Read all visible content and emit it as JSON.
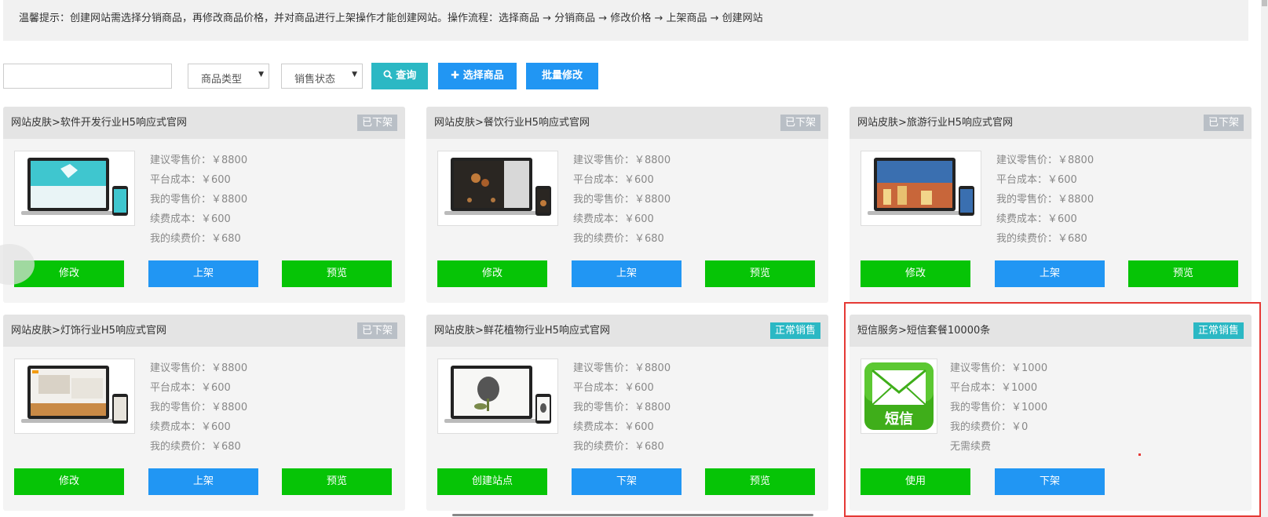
{
  "tip": "温馨提示：创建网站需选择分销商品，再修改商品价格，并对商品进行上架操作才能创建网站。操作流程：选择商品 → 分销商品 → 修改价格 → 上架商品 → 创建网站",
  "toolbar": {
    "search_value": "",
    "type_select": "商品类型",
    "status_select": "销售状态",
    "query_label": "查询",
    "choose_label": "选择商品",
    "batch_label": "批量修改"
  },
  "cards": [
    {
      "title": "网站皮肤>软件开发行业H5响应式官网",
      "badge": "已下架",
      "lines": [
        "建议零售价：￥8800",
        "平台成本：￥600",
        "我的零售价：￥8800",
        "续费成本：￥600",
        "我的续费价：￥680"
      ],
      "buttons": [
        "修改",
        "上架",
        "预览"
      ]
    },
    {
      "title": "网站皮肤>餐饮行业H5响应式官网",
      "badge": "已下架",
      "lines": [
        "建议零售价：￥8800",
        "平台成本：￥600",
        "我的零售价：￥8800",
        "续费成本：￥600",
        "我的续费价：￥680"
      ],
      "buttons": [
        "修改",
        "上架",
        "预览"
      ]
    },
    {
      "title": "网站皮肤>旅游行业H5响应式官网",
      "badge": "已下架",
      "lines": [
        "建议零售价：￥8800",
        "平台成本：￥600",
        "我的零售价：￥8800",
        "续费成本：￥600",
        "我的续费价：￥680"
      ],
      "buttons": [
        "修改",
        "上架",
        "预览"
      ]
    },
    {
      "title": "网站皮肤>灯饰行业H5响应式官网",
      "badge": "已下架",
      "lines": [
        "建议零售价：￥8800",
        "平台成本：￥600",
        "我的零售价：￥8800",
        "续费成本：￥600",
        "我的续费价：￥680"
      ],
      "buttons": [
        "修改",
        "上架",
        "预览"
      ]
    },
    {
      "title": "网站皮肤>鲜花植物行业H5响应式官网",
      "badge": "正常销售",
      "lines": [
        "建议零售价：￥8800",
        "平台成本：￥600",
        "我的零售价：￥8800",
        "续费成本：￥600",
        "我的续费价：￥680"
      ],
      "buttons": [
        "创建站点",
        "下架",
        "预览"
      ]
    },
    {
      "title": "短信服务>短信套餐10000条",
      "badge": "正常销售",
      "lines": [
        "建议零售价：￥1000",
        "平台成本：￥1000",
        "我的零售价：￥1000",
        "我的续费价：￥0",
        "无需续费"
      ],
      "buttons": [
        "使用",
        "下架"
      ],
      "sms_icon_text": "短信"
    }
  ],
  "colors": {
    "green": "#06c406",
    "blue": "#2196f3",
    "teal": "#2bb8c4",
    "badge_off": "#b9bfc6",
    "highlight": "#e53935"
  }
}
